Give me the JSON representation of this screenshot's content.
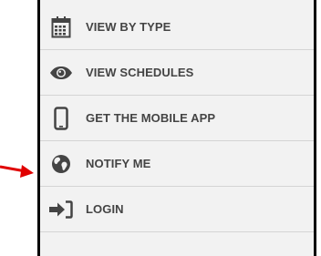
{
  "menu": {
    "items": [
      {
        "label": "VIEW BY TYPE",
        "icon": "calendar-icon"
      },
      {
        "label": "VIEW SCHEDULES",
        "icon": "eye-icon"
      },
      {
        "label": "GET THE MOBILE APP",
        "icon": "mobile-phone-icon"
      },
      {
        "label": "NOTIFY ME",
        "icon": "globe-icon"
      },
      {
        "label": "LOGIN",
        "icon": "login-icon"
      }
    ]
  },
  "colors": {
    "panel_background": "#f2f2f2",
    "item_text": "#444444",
    "icon": "#444444",
    "divider": "#d4d4d4",
    "frame_border": "#000000",
    "pointer_arrow": "#e00000"
  }
}
